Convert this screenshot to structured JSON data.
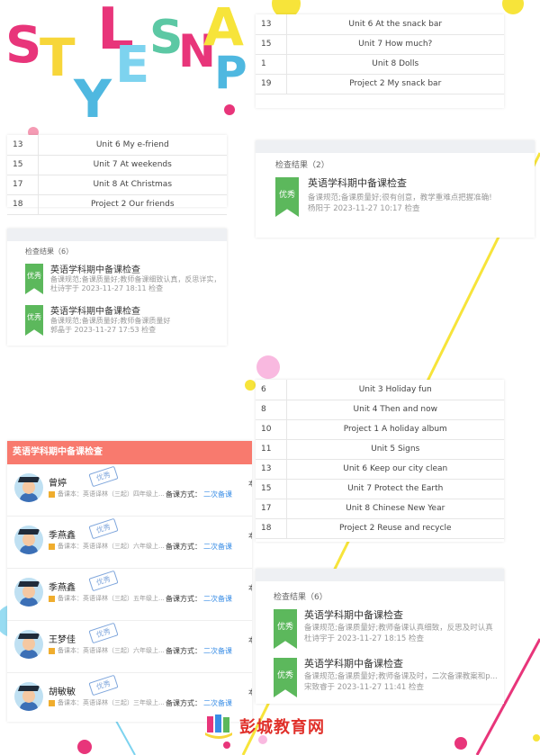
{
  "panel_top_right": {
    "rows": [
      {
        "num": "13",
        "title": "Unit 6 At the snack bar"
      },
      {
        "num": "15",
        "title": "Unit 7 How much?"
      },
      {
        "num": "1",
        "title": "Unit 8 Dolls"
      },
      {
        "num": "19",
        "title": "Project 2 My snack bar"
      }
    ]
  },
  "panel_top_left": {
    "rows": [
      {
        "num": "13",
        "title": "Unit 6 My e-friend"
      },
      {
        "num": "15",
        "title": "Unit 7 At weekends"
      },
      {
        "num": "17",
        "title": "Unit 8 At Christmas"
      },
      {
        "num": "18",
        "title": "Project 2 Our friends"
      }
    ]
  },
  "results_right_1": {
    "header": "检查结果（2）",
    "items": [
      {
        "badge": "优秀",
        "title": "英语学科期中备课检查",
        "desc": "备课规范;备课质量好;很有创意，教学重难点把握准确!",
        "meta": "杨阳于 2023-11-27 10:17 检查"
      }
    ]
  },
  "results_left_1": {
    "header": "检查结果（6）",
    "items": [
      {
        "badge": "优秀",
        "title": "英语学科期中备课检查",
        "desc": "备课规范;备课质量好;教师备课细致认真，反思详实，...",
        "meta": "杜诗宇于 2023-11-27 18:11 检查"
      },
      {
        "badge": "优秀",
        "title": "英语学科期中备课检查",
        "desc": "备课规范;备课质量好;教师备课质量好",
        "meta": "郭晶于 2023-11-27 17:53 检查"
      }
    ]
  },
  "panel_mid_right": {
    "rows": [
      {
        "num": "6",
        "title": "Unit 3 Holiday fun"
      },
      {
        "num": "8",
        "title": "Unit 4 Then and now"
      },
      {
        "num": "10",
        "title": "Project 1 A holiday album"
      },
      {
        "num": "11",
        "title": "Unit 5 Signs"
      },
      {
        "num": "13",
        "title": "Unit 6 Keep our city clean"
      },
      {
        "num": "15",
        "title": "Unit 7 Protect the Earth"
      },
      {
        "num": "17",
        "title": "Unit 8 Chinese New Year"
      },
      {
        "num": "18",
        "title": "Project 2 Reuse and recycle"
      }
    ]
  },
  "teacher_panel": {
    "header": "英语学科期中备课检查",
    "mode_label": "备课方式：",
    "teachers": [
      {
        "name": "曾婷",
        "badge": "优秀",
        "book": "备课本：英语译林（三起）四年级上...",
        "mode": "二次备课",
        "cut": "本"
      },
      {
        "name": "季燕鑫",
        "badge": "优秀",
        "book": "备课本：英语译林（三起）六年级上...",
        "mode": "二次备课",
        "cut": "本"
      },
      {
        "name": "季燕鑫",
        "badge": "优秀",
        "book": "备课本：英语译林（三起）五年级上...",
        "mode": "二次备课",
        "cut": "本"
      },
      {
        "name": "王梦佳",
        "badge": "优秀",
        "book": "备课本：英语译林（三起）六年级上...",
        "mode": "二次备课",
        "cut": "本"
      },
      {
        "name": "胡敏敏",
        "badge": "优秀",
        "book": "备课本：英语译林（三起）三年级上...",
        "mode": "二次备课",
        "cut": "本"
      }
    ]
  },
  "results_right_2": {
    "header": "检查结果（6）",
    "items": [
      {
        "badge": "优秀",
        "title": "英语学科期中备课检查",
        "desc": "备课规范;备课质量好;教师备课认真细致，反思及时认真",
        "meta": "杜诗宇于 2023-11-27 18:15 检查"
      },
      {
        "badge": "优秀",
        "title": "英语学科期中备课检查",
        "desc": "备课规范;备课质量好;教师备课及时，二次备课教案和p...",
        "meta": "宋致睿于 2023-11-27 11:41 检查"
      }
    ]
  },
  "watermark": {
    "text": "彭城教育网"
  },
  "logo_letters": [
    "S",
    "T",
    "Y",
    "L",
    "E",
    "S",
    "N",
    "A",
    "P"
  ],
  "colors": {
    "accent_red": "#f87a6e",
    "badge_green": "#5cb85c",
    "link_blue": "#3a8ee6",
    "pink": "#e8357a",
    "yellow": "#f7e43a",
    "cyan": "#7dd3ef"
  }
}
